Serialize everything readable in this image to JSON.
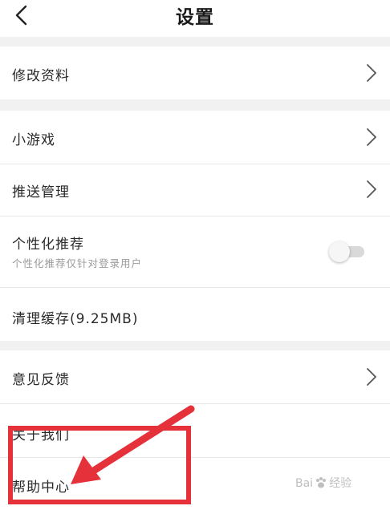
{
  "header": {
    "title": "设置"
  },
  "rows": {
    "edit_profile": "修改资料",
    "mini_games": "小游戏",
    "push_management": "推送管理",
    "personalized": "个性化推荐",
    "personalized_sub": "个性化推荐仅针对登录用户",
    "personalized_enabled": false,
    "clear_cache": "清理缓存(9.25MB)",
    "feedback": "意见反馈",
    "about_us": "关于我们",
    "help_center": "帮助中心"
  },
  "watermark": {
    "text_left": "Bai",
    "text_right": "经验"
  },
  "colors": {
    "annotation_red": "#e5313a",
    "section_gap": "#f1f1f1",
    "toggle_off_track": "#d9d9d9"
  }
}
